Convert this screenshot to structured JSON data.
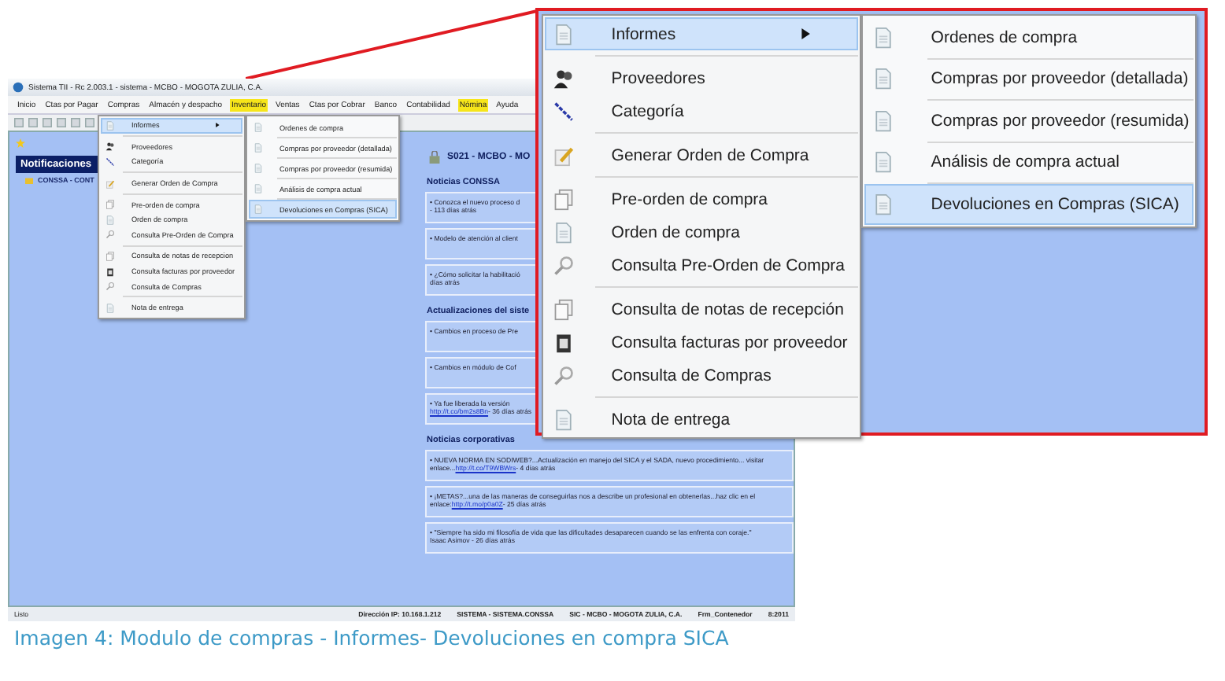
{
  "app_window": {
    "title": "Sistema TII - Rc 2.003.1 - sistema - MCBO - MOGOTA ZULIA, C.A.",
    "menu_bar": [
      {
        "label": "Inicio",
        "highlighted": false
      },
      {
        "label": "Ctas por Pagar",
        "highlighted": false
      },
      {
        "label": "Compras",
        "highlighted": false
      },
      {
        "label": "Almacén y despacho",
        "highlighted": false
      },
      {
        "label": "Inventario",
        "highlighted": true
      },
      {
        "label": "Ventas",
        "highlighted": false
      },
      {
        "label": "Ctas por Cobrar",
        "highlighted": false
      },
      {
        "label": "Banco",
        "highlighted": false
      },
      {
        "label": "Contabilidad",
        "highlighted": false
      },
      {
        "label": "Nómina",
        "highlighted": true
      },
      {
        "label": "Ayuda",
        "highlighted": false
      }
    ],
    "menu": [
      {
        "kind": "item",
        "label": "Informes",
        "selected": true,
        "submenu": true
      },
      {
        "kind": "separator"
      },
      {
        "kind": "item",
        "label": "Proveedores",
        "selected": false,
        "submenu": false
      },
      {
        "kind": "item",
        "label": "Categoría",
        "selected": false,
        "submenu": false
      },
      {
        "kind": "separator"
      },
      {
        "kind": "item",
        "label": "Generar Orden de Compra",
        "selected": false,
        "submenu": false
      },
      {
        "kind": "separator"
      },
      {
        "kind": "item",
        "label": "Pre-orden de compra",
        "selected": false,
        "submenu": false
      },
      {
        "kind": "item",
        "label": "Orden de compra",
        "selected": false,
        "submenu": false
      },
      {
        "kind": "item",
        "label": "Consulta Pre-Orden de Compra",
        "selected": false,
        "submenu": false
      },
      {
        "kind": "separator"
      },
      {
        "kind": "item",
        "label": "Consulta de notas de recepcion",
        "selected": false,
        "submenu": false
      },
      {
        "kind": "item",
        "label": "Consulta facturas por proveedor",
        "selected": false,
        "submenu": false
      },
      {
        "kind": "item",
        "label": "Consulta de Compras",
        "selected": false,
        "submenu": false
      },
      {
        "kind": "separator"
      },
      {
        "kind": "item",
        "label": "Nota de entrega",
        "selected": false,
        "submenu": false
      }
    ],
    "submenu": [
      {
        "label": "Ordenes de compra",
        "selected": false
      },
      {
        "label": "Compras por proveedor (detallada)",
        "selected": false
      },
      {
        "label": "Compras por proveedor (resumida)",
        "selected": false
      },
      {
        "label": "Análisis de compra actual",
        "selected": false
      },
      {
        "label": "Devoluciones en Compras (SICA)",
        "selected": true
      }
    ],
    "notifications": {
      "header": "Notificaciones",
      "items": [
        "CONSSA - CONT"
      ]
    },
    "news_panel": {
      "title": "S021 - MCBO - MO",
      "sections": [
        {
          "heading": "Noticias CONSSA",
          "cards": [
            {
              "lines": [
                {
                  "text": "• Conozca el nuevo proceso d"
                },
                {
                  "text": "- 113 días atrás"
                }
              ]
            },
            {
              "lines": [
                {
                  "text": "• Modelo de atención al client"
                }
              ]
            },
            {
              "lines": [
                {
                  "text": "• ¿Cómo solicitar la habilitació"
                },
                {
                  "text": "días atrás"
                }
              ]
            }
          ]
        },
        {
          "heading": "Actualizaciones del siste",
          "cards": [
            {
              "lines": [
                {
                  "text": "• Cambios en proceso de Pre"
                }
              ]
            },
            {
              "lines": [
                {
                  "text": "• Cambios en módulo de Cof"
                }
              ]
            },
            {
              "lines": [
                {
                  "text": "• Ya fue liberada la versión"
                },
                {
                  "link": "http://t.co/bm2s8Bn",
                  "text": " - 36 días atrás"
                }
              ]
            }
          ]
        },
        {
          "heading": "Noticias corporativas",
          "cards": [
            {
              "lines": [
                {
                  "text": "• NUEVA NORMA EN SODIWEB?...Actualización en manejo del SICA y el SADA, nuevo procedimiento... visitar"
                },
                {
                  "text": "enlace... ",
                  "link": "http://t.co/T9WBWrs",
                  "after": " - 4 días atrás"
                }
              ]
            },
            {
              "lines": [
                {
                  "text": "• ¡METAS?...una de las maneras de conseguirlas nos a describe un profesional en obtenerlas...haz clic en el"
                },
                {
                  "text": "enlace: ",
                  "link": "http://t.mo/p0a0Z",
                  "after": " - 25 días atrás"
                }
              ]
            },
            {
              "lines": [
                {
                  "text": "• \"Siempre ha sido mi filosofía de vida que las dificultades desaparecen cuando se las enfrenta con coraje.\""
                },
                {
                  "text": "Isaac Asimov - 26 días atrás"
                }
              ]
            }
          ]
        }
      ]
    },
    "status_bar": [
      "Listo",
      "Dirección IP: 10.168.1.212",
      "SISTEMA - SISTEMA.CONSSA",
      "SIC - MCBO - MOGOTA ZULIA, C.A.",
      "Frm_Contenedor",
      "8:2011"
    ]
  },
  "magnified_inset": {
    "menu": [
      {
        "kind": "item",
        "label": "Informes",
        "selected": true,
        "submenu": true
      },
      {
        "kind": "separator"
      },
      {
        "kind": "item",
        "label": "Proveedores",
        "selected": false,
        "submenu": false
      },
      {
        "kind": "item",
        "label": "Categoría",
        "selected": false,
        "submenu": false
      },
      {
        "kind": "separator"
      },
      {
        "kind": "item",
        "label": "Generar Orden de Compra",
        "selected": false,
        "submenu": false
      },
      {
        "kind": "separator"
      },
      {
        "kind": "item",
        "label": "Pre-orden de compra",
        "selected": false,
        "submenu": false
      },
      {
        "kind": "item",
        "label": "Orden de compra",
        "selected": false,
        "submenu": false
      },
      {
        "kind": "item",
        "label": "Consulta Pre-Orden de Compra",
        "selected": false,
        "submenu": false
      },
      {
        "kind": "separator"
      },
      {
        "kind": "item",
        "label": "Consulta de notas de recepción",
        "selected": false,
        "submenu": false
      },
      {
        "kind": "item",
        "label": "Consulta facturas por proveedor",
        "selected": false,
        "submenu": false
      },
      {
        "kind": "item",
        "label": "Consulta de Compras",
        "selected": false,
        "submenu": false
      },
      {
        "kind": "separator"
      },
      {
        "kind": "item",
        "label": "Nota de entrega",
        "selected": false,
        "submenu": false
      }
    ],
    "submenu": [
      {
        "label": "Ordenes de compra",
        "selected": false
      },
      {
        "label": "Compras por proveedor (detallada)",
        "selected": false
      },
      {
        "label": "Compras por proveedor (resumida)",
        "selected": false
      },
      {
        "label": "Análisis de compra actual",
        "selected": false
      },
      {
        "label": "Devoluciones en Compras (SICA)",
        "selected": true
      }
    ]
  },
  "caption": "Imagen 4: Modulo de compras - Informes- Devoluciones en compra SICA"
}
